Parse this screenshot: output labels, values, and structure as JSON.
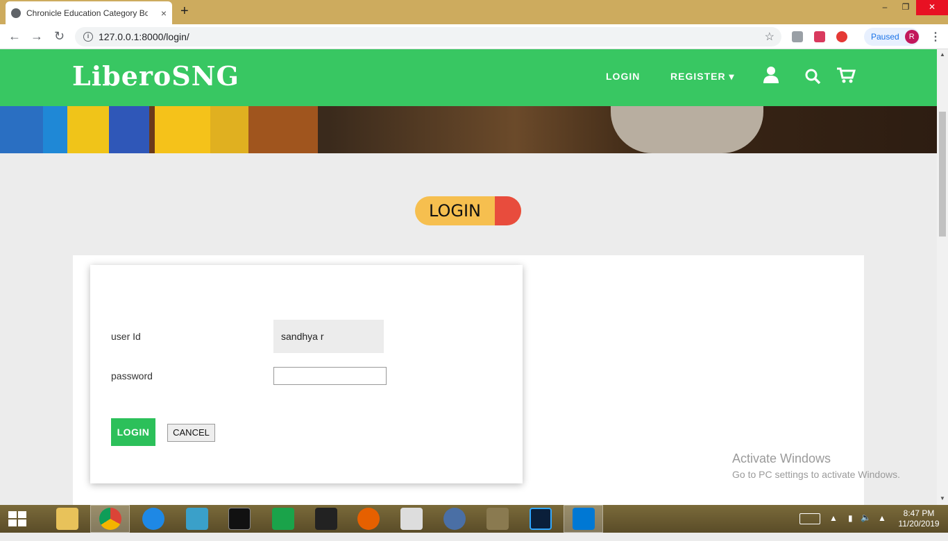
{
  "browser": {
    "tab_title": "Chronicle Education Category Bo",
    "tab_close": "×",
    "new_tab": "+",
    "url": "127.0.0.1:8000/login/",
    "paused_label": "Paused",
    "profile_initial": "R",
    "min": "–",
    "max": "❐",
    "close": "✕"
  },
  "site": {
    "logo": "LiberoSNG",
    "nav": {
      "login": "LOGIN",
      "register": "REGISTER ▾"
    }
  },
  "page": {
    "badge": "LOGIN",
    "form": {
      "user_id_label": "user Id",
      "user_id_value": "sandhya r",
      "password_label": "password",
      "login_button": "LOGIN",
      "cancel_button": "CANCEL"
    },
    "activate": {
      "title": "Activate Windows",
      "subtitle": "Go to PC settings to activate Windows."
    }
  },
  "taskbar": {
    "time": "8:47 PM",
    "date": "11/20/2019"
  },
  "colors": {
    "nav_green": "#38c762",
    "button_green": "#2cc05a",
    "badge_yellow": "#f6bf4f",
    "badge_red": "#e84c3d"
  }
}
